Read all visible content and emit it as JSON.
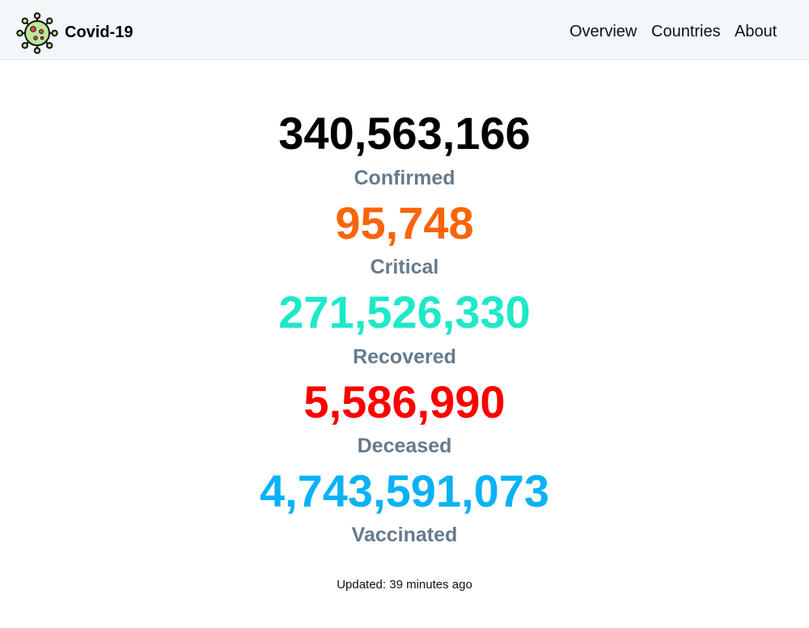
{
  "header": {
    "brand": "Covid-19",
    "logo_icon": "virus-icon",
    "nav": [
      "Overview",
      "Countries",
      "About"
    ]
  },
  "stats": [
    {
      "value": "340,563,166",
      "label": "Confirmed",
      "color": "#000000"
    },
    {
      "value": "95,748",
      "label": "Critical",
      "color": "#fa640a"
    },
    {
      "value": "271,526,330",
      "label": "Recovered",
      "color": "#1de9c9"
    },
    {
      "value": "5,586,990",
      "label": "Deceased",
      "color": "#ff0000"
    },
    {
      "value": "4,743,591,073",
      "label": "Vaccinated",
      "color": "#0ab2f5"
    }
  ],
  "footer": {
    "updated": "Updated: 39 minutes ago"
  },
  "colors": {
    "header_bg": "#f4f7fa",
    "label": "#667a8c",
    "virus_body": "#bde69a",
    "virus_spots": "#e34a4a"
  }
}
